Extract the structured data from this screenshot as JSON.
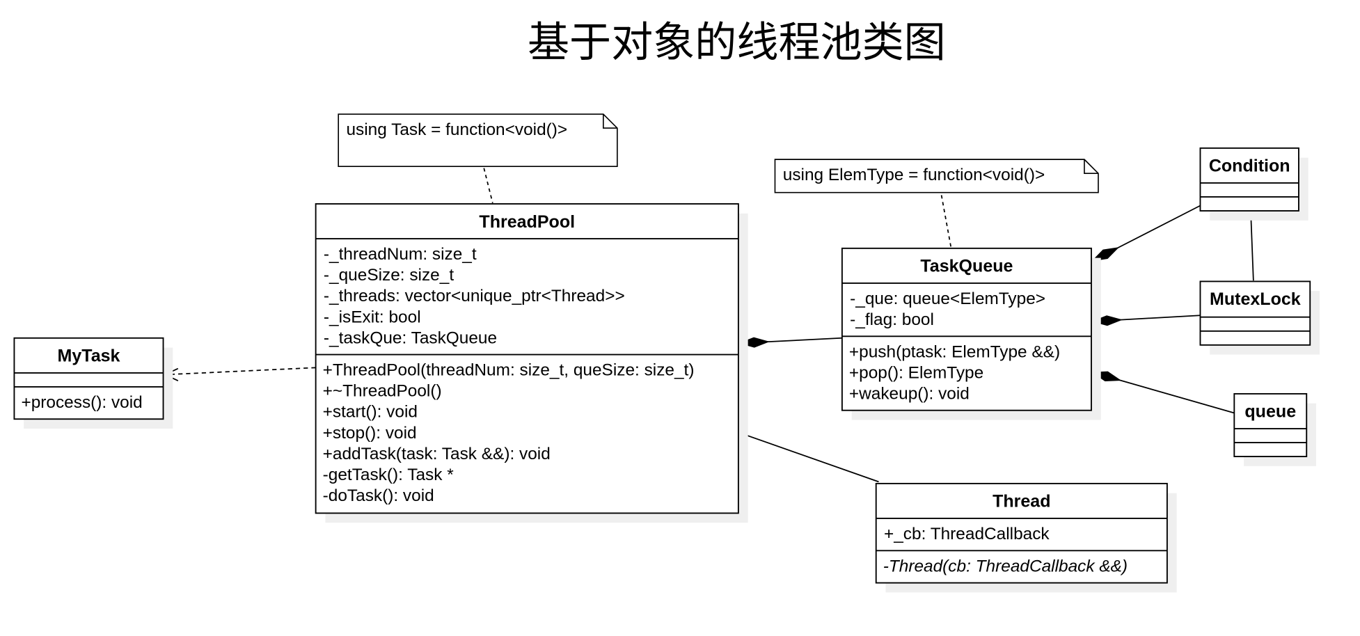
{
  "title": "基于对象的线程池类图",
  "notes": [
    {
      "id": "note-task-alias",
      "text": "using Task = function<void()>"
    },
    {
      "id": "note-elemtype-alias",
      "text": "using ElemType = function<void()>"
    }
  ],
  "classes": [
    {
      "id": "threadpool",
      "name": "ThreadPool",
      "attributes": [
        "-_threadNum: size_t",
        "-_queSize: size_t",
        "-_threads: vector<unique_ptr<Thread>>",
        "-_isExit: bool",
        "-_taskQue: TaskQueue"
      ],
      "methods": [
        "+ThreadPool(threadNum: size_t, queSize: size_t)",
        "+~ThreadPool()",
        "+start(): void",
        "+stop(): void",
        "+addTask(task: Task &&): void",
        "-getTask(): Task *",
        "-doTask(): void"
      ]
    },
    {
      "id": "mytask",
      "name": "MyTask",
      "attributes": [],
      "methods": [
        "+process(): void"
      ]
    },
    {
      "id": "taskqueue",
      "name": "TaskQueue",
      "attributes": [
        "-_que: queue<ElemType>",
        "-_flag: bool"
      ],
      "methods": [
        "+push(ptask: ElemType &&)",
        "+pop(): ElemType",
        "+wakeup(): void"
      ]
    },
    {
      "id": "condition",
      "name": "Condition",
      "attributes": [],
      "methods": []
    },
    {
      "id": "mutexlock",
      "name": "MutexLock",
      "attributes": [],
      "methods": []
    },
    {
      "id": "queue",
      "name": "queue",
      "attributes": [],
      "methods": []
    },
    {
      "id": "thread",
      "name": "Thread",
      "attributes": [
        "+_cb: ThreadCallback"
      ],
      "methods": [
        "-Thread(cb: ThreadCallback &&)"
      ],
      "methods_italic": true
    }
  ],
  "relations": [
    {
      "type": "dependency",
      "from": "threadpool",
      "to": "mytask"
    },
    {
      "type": "composition",
      "whole": "threadpool",
      "part": "taskqueue"
    },
    {
      "type": "composition",
      "whole": "taskqueue",
      "part": "condition"
    },
    {
      "type": "composition",
      "whole": "taskqueue",
      "part": "mutexlock"
    },
    {
      "type": "composition",
      "whole": "taskqueue",
      "part": "queue"
    },
    {
      "type": "association",
      "from": "threadpool",
      "to": "thread"
    },
    {
      "type": "association",
      "from": "condition",
      "to": "mutexlock"
    },
    {
      "type": "note-anchor",
      "from": "note-task-alias",
      "to": "threadpool"
    },
    {
      "type": "note-anchor",
      "from": "note-elemtype-alias",
      "to": "taskqueue"
    }
  ]
}
